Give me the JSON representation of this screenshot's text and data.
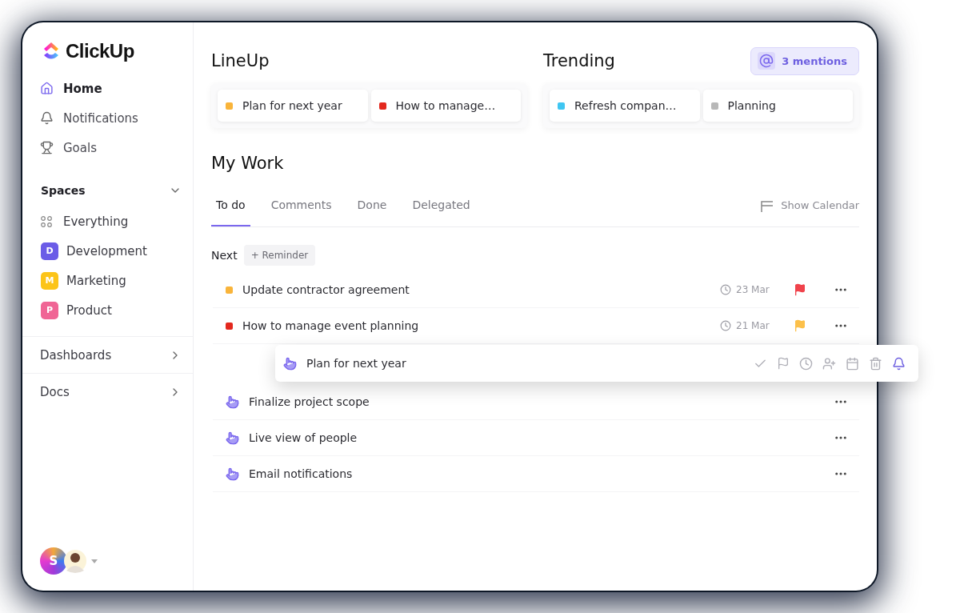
{
  "logo": {
    "text": "ClickUp"
  },
  "nav": [
    {
      "label": "Home",
      "selected": true
    },
    {
      "label": "Notifications",
      "selected": false
    },
    {
      "label": "Goals",
      "selected": false
    }
  ],
  "spaces": {
    "title": "Spaces",
    "items": [
      {
        "kind": "all",
        "label": "Everything"
      },
      {
        "kind": "space",
        "letter": "D",
        "label": "Development",
        "color": "#6b5ce7"
      },
      {
        "kind": "space",
        "letter": "M",
        "label": "Marketing",
        "color": "#fcc419"
      },
      {
        "kind": "space",
        "letter": "P",
        "label": "Product",
        "color": "#f06595"
      }
    ]
  },
  "sections": [
    {
      "label": "Dashboards"
    },
    {
      "label": "Docs"
    }
  ],
  "user": {
    "initial": "S"
  },
  "lineup": {
    "title": "LineUp",
    "items": [
      {
        "label": "Plan for next year",
        "color": "#f9b43a"
      },
      {
        "label": "How to manage…",
        "color": "#e3281e"
      }
    ]
  },
  "trending": {
    "title": "Trending",
    "items": [
      {
        "label": "Refresh compan…",
        "color": "#3fc6f2"
      },
      {
        "label": "Planning",
        "color": "#b8b8b8"
      }
    ]
  },
  "mentions": {
    "label": "3 mentions"
  },
  "my_work": {
    "title": "My Work",
    "tabs": [
      {
        "label": "To do",
        "selected": true
      },
      {
        "label": "Comments",
        "selected": false
      },
      {
        "label": "Done",
        "selected": false
      },
      {
        "label": "Delegated",
        "selected": false
      }
    ],
    "show_calendar": "Show Calendar",
    "group": {
      "label": "Next",
      "reminder": "+ Reminder"
    },
    "tasks": [
      {
        "kind": "task",
        "label": "Update contractor agreement",
        "color": "#f9b43a",
        "date": "23 Mar",
        "flag": {
          "color": "#f0434c"
        }
      },
      {
        "kind": "task",
        "label": "How to manage event planning",
        "color": "#e3281e",
        "date": "21 Mar",
        "flag": {
          "color": "#fcc04a"
        }
      },
      {
        "kind": "reminder",
        "label": "Finalize project scope"
      },
      {
        "kind": "reminder",
        "label": "Live view of people"
      },
      {
        "kind": "reminder",
        "label": "Email notifications"
      }
    ]
  },
  "drag_card": {
    "title": "Plan for next year"
  }
}
